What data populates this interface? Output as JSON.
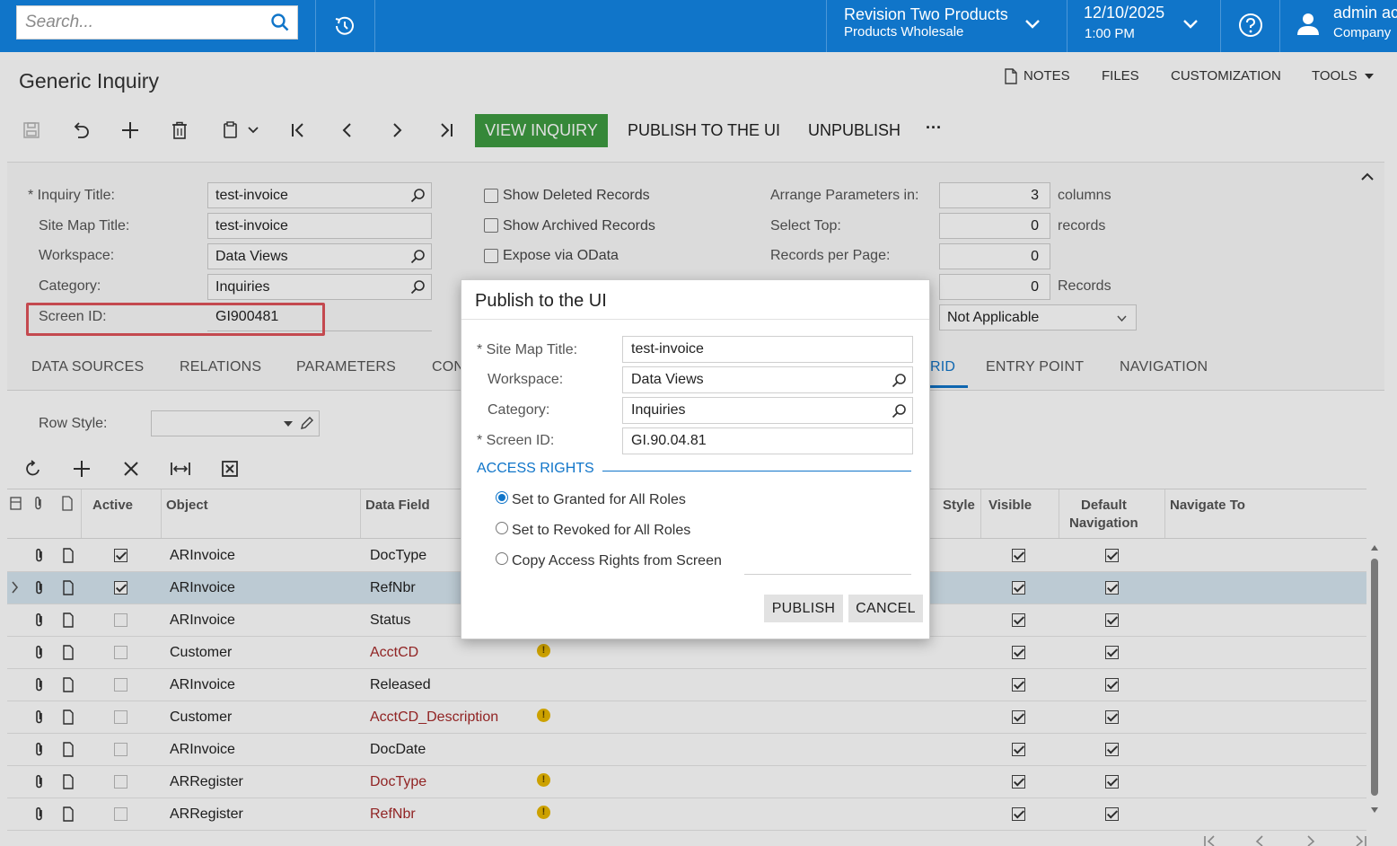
{
  "topbar": {
    "search_placeholder": "Search...",
    "company_line1": "Revision Two Products",
    "company_line2": "Products Wholesale",
    "date": "12/10/2025",
    "time": "1:00 PM",
    "user_name": "admin ac",
    "user_company": "Company"
  },
  "page": {
    "title": "Generic Inquiry",
    "menu": {
      "notes": "NOTES",
      "files": "FILES",
      "customization": "CUSTOMIZATION",
      "tools": "TOOLS"
    }
  },
  "toolbar": {
    "view_inquiry": "VIEW INQUIRY",
    "publish": "PUBLISH TO THE UI",
    "unpublish": "UNPUBLISH",
    "more": "···"
  },
  "form": {
    "inquiry_title_label": "Inquiry Title:",
    "inquiry_title": "test-invoice",
    "site_map_title_label": "Site Map Title:",
    "site_map_title": "test-invoice",
    "workspace_label": "Workspace:",
    "workspace": "Data Views",
    "category_label": "Category:",
    "category": "Inquiries",
    "screen_id_label": "Screen ID:",
    "screen_id": "GI900481",
    "show_deleted": "Show Deleted Records",
    "show_archived": "Show Archived Records",
    "expose_odata": "Expose via OData",
    "arrange_label": "Arrange Parameters in:",
    "arrange_value": "3",
    "arrange_unit": "columns",
    "select_top_label": "Select Top:",
    "select_top_value": "0",
    "select_top_unit": "records",
    "records_per_page_label": "Records per Page:",
    "records_per_page_value": "0",
    "fourth_value": "0",
    "fourth_unit": "Records",
    "dropdown_value": "Not Applicable"
  },
  "tabs": [
    "DATA SOURCES",
    "RELATIONS",
    "PARAMETERS",
    "CON",
    "RID",
    "ENTRY POINT",
    "NAVIGATION"
  ],
  "grid": {
    "row_style_label": "Row Style:",
    "headers": {
      "active": "Active",
      "object": "Object",
      "data_field": "Data Field",
      "style": "Style",
      "visible": "Visible",
      "default_nav_1": "Default",
      "default_nav_2": "Navigation",
      "navigate_to": "Navigate To"
    },
    "rows": [
      {
        "active": true,
        "object": "ARInvoice",
        "field": "DocType",
        "warn": false,
        "visible": true,
        "default_nav": true
      },
      {
        "active": true,
        "object": "ARInvoice",
        "field": "RefNbr",
        "warn": false,
        "visible": true,
        "default_nav": true
      },
      {
        "active": false,
        "object": "ARInvoice",
        "field": "Status",
        "warn": false,
        "visible": true,
        "default_nav": true
      },
      {
        "active": false,
        "object": "Customer",
        "field": "AcctCD",
        "warn": true,
        "visible": true,
        "default_nav": true
      },
      {
        "active": false,
        "object": "ARInvoice",
        "field": "Released",
        "warn": false,
        "visible": true,
        "default_nav": true
      },
      {
        "active": false,
        "object": "Customer",
        "field": "AcctCD_Description",
        "warn": true,
        "visible": true,
        "default_nav": true
      },
      {
        "active": false,
        "object": "ARInvoice",
        "field": "DocDate",
        "warn": false,
        "visible": true,
        "default_nav": true
      },
      {
        "active": false,
        "object": "ARRegister",
        "field": "DocType",
        "warn": true,
        "visible": true,
        "default_nav": true
      },
      {
        "active": false,
        "object": "ARRegister",
        "field": "RefNbr",
        "warn": true,
        "visible": true,
        "default_nav": true
      }
    ]
  },
  "dialog": {
    "title": "Publish to the UI",
    "site_map_title_label": "Site Map Title:",
    "site_map_title": "test-invoice",
    "workspace_label": "Workspace:",
    "workspace": "Data Views",
    "category_label": "Category:",
    "category": "Inquiries",
    "screen_id_label": "Screen ID:",
    "screen_id": "GI.90.04.81",
    "access_rights": "ACCESS RIGHTS",
    "radio_granted": "Set to Granted for All Roles",
    "radio_revoked": "Set to Revoked for All Roles",
    "radio_copy": "Copy Access Rights from Screen",
    "publish": "PUBLISH",
    "cancel": "CANCEL"
  },
  "colors": {
    "brand": "#1075c9",
    "green": "#3e9b41",
    "highlight": "#e0545a",
    "warning": "#e9b800"
  }
}
